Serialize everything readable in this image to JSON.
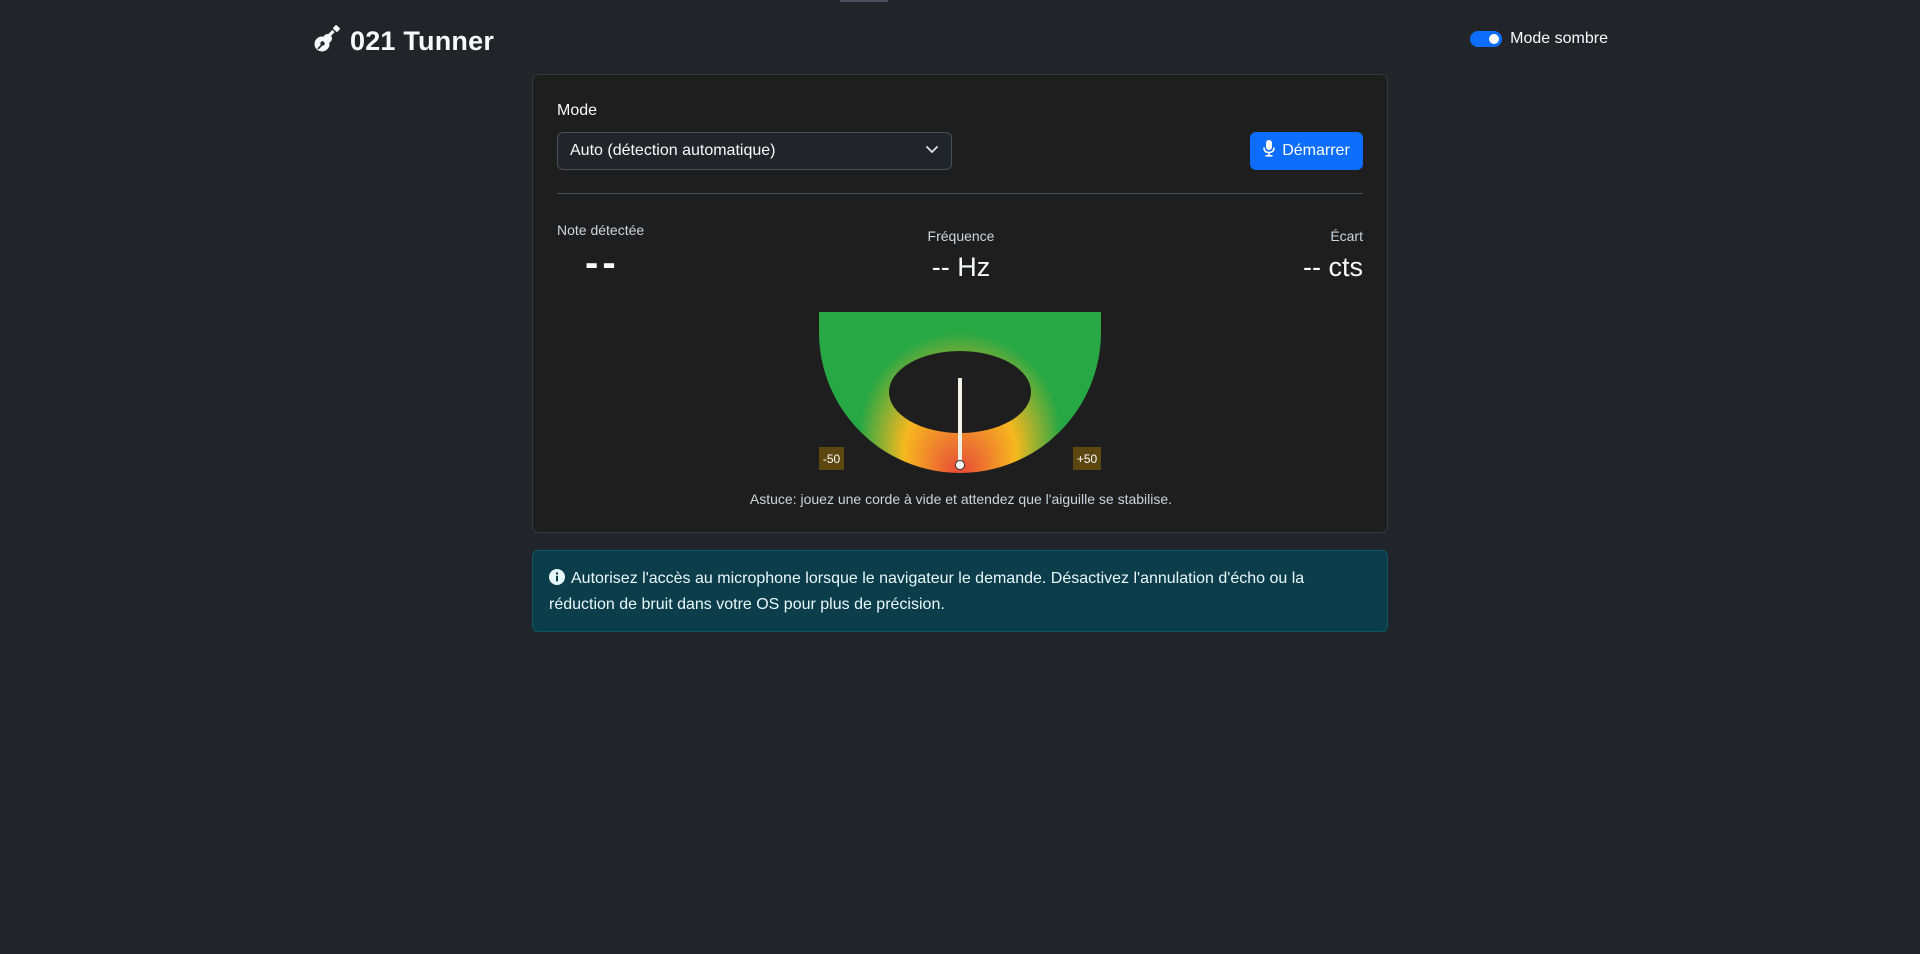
{
  "header": {
    "title": "021 Tunner",
    "dark_mode_label": "Mode sombre",
    "dark_mode_on": true
  },
  "tuner": {
    "mode_label": "Mode",
    "mode_selected": "Auto (détection automatique)",
    "start_button": "Démarrer",
    "note_label": "Note détectée",
    "note_value": "--",
    "frequency_label": "Fréquence",
    "frequency_value": "-- Hz",
    "deviation_label": "Écart",
    "deviation_value": "-- cts",
    "gauge_min_label": "-50",
    "gauge_max_label": "+50",
    "needle_cents": 0,
    "tip": "Astuce: jouez une corde à vide et attendez que l'aiguille se stabilise."
  },
  "alert": {
    "icon": "info-icon",
    "text": "Autorisez l'accès au microphone lorsque le navigateur le demande. Désactivez l'annulation d'écho ou la réduction de bruit dans votre OS pour plus de précision."
  },
  "colors": {
    "accent": "#0d6efd",
    "background": "#212529",
    "card": "#1e1e1e",
    "alert_bg": "#0b3d4a",
    "gauge_green": "#28a745",
    "gauge_yellow": "#f6b81f",
    "gauge_red": "#e8463a"
  }
}
